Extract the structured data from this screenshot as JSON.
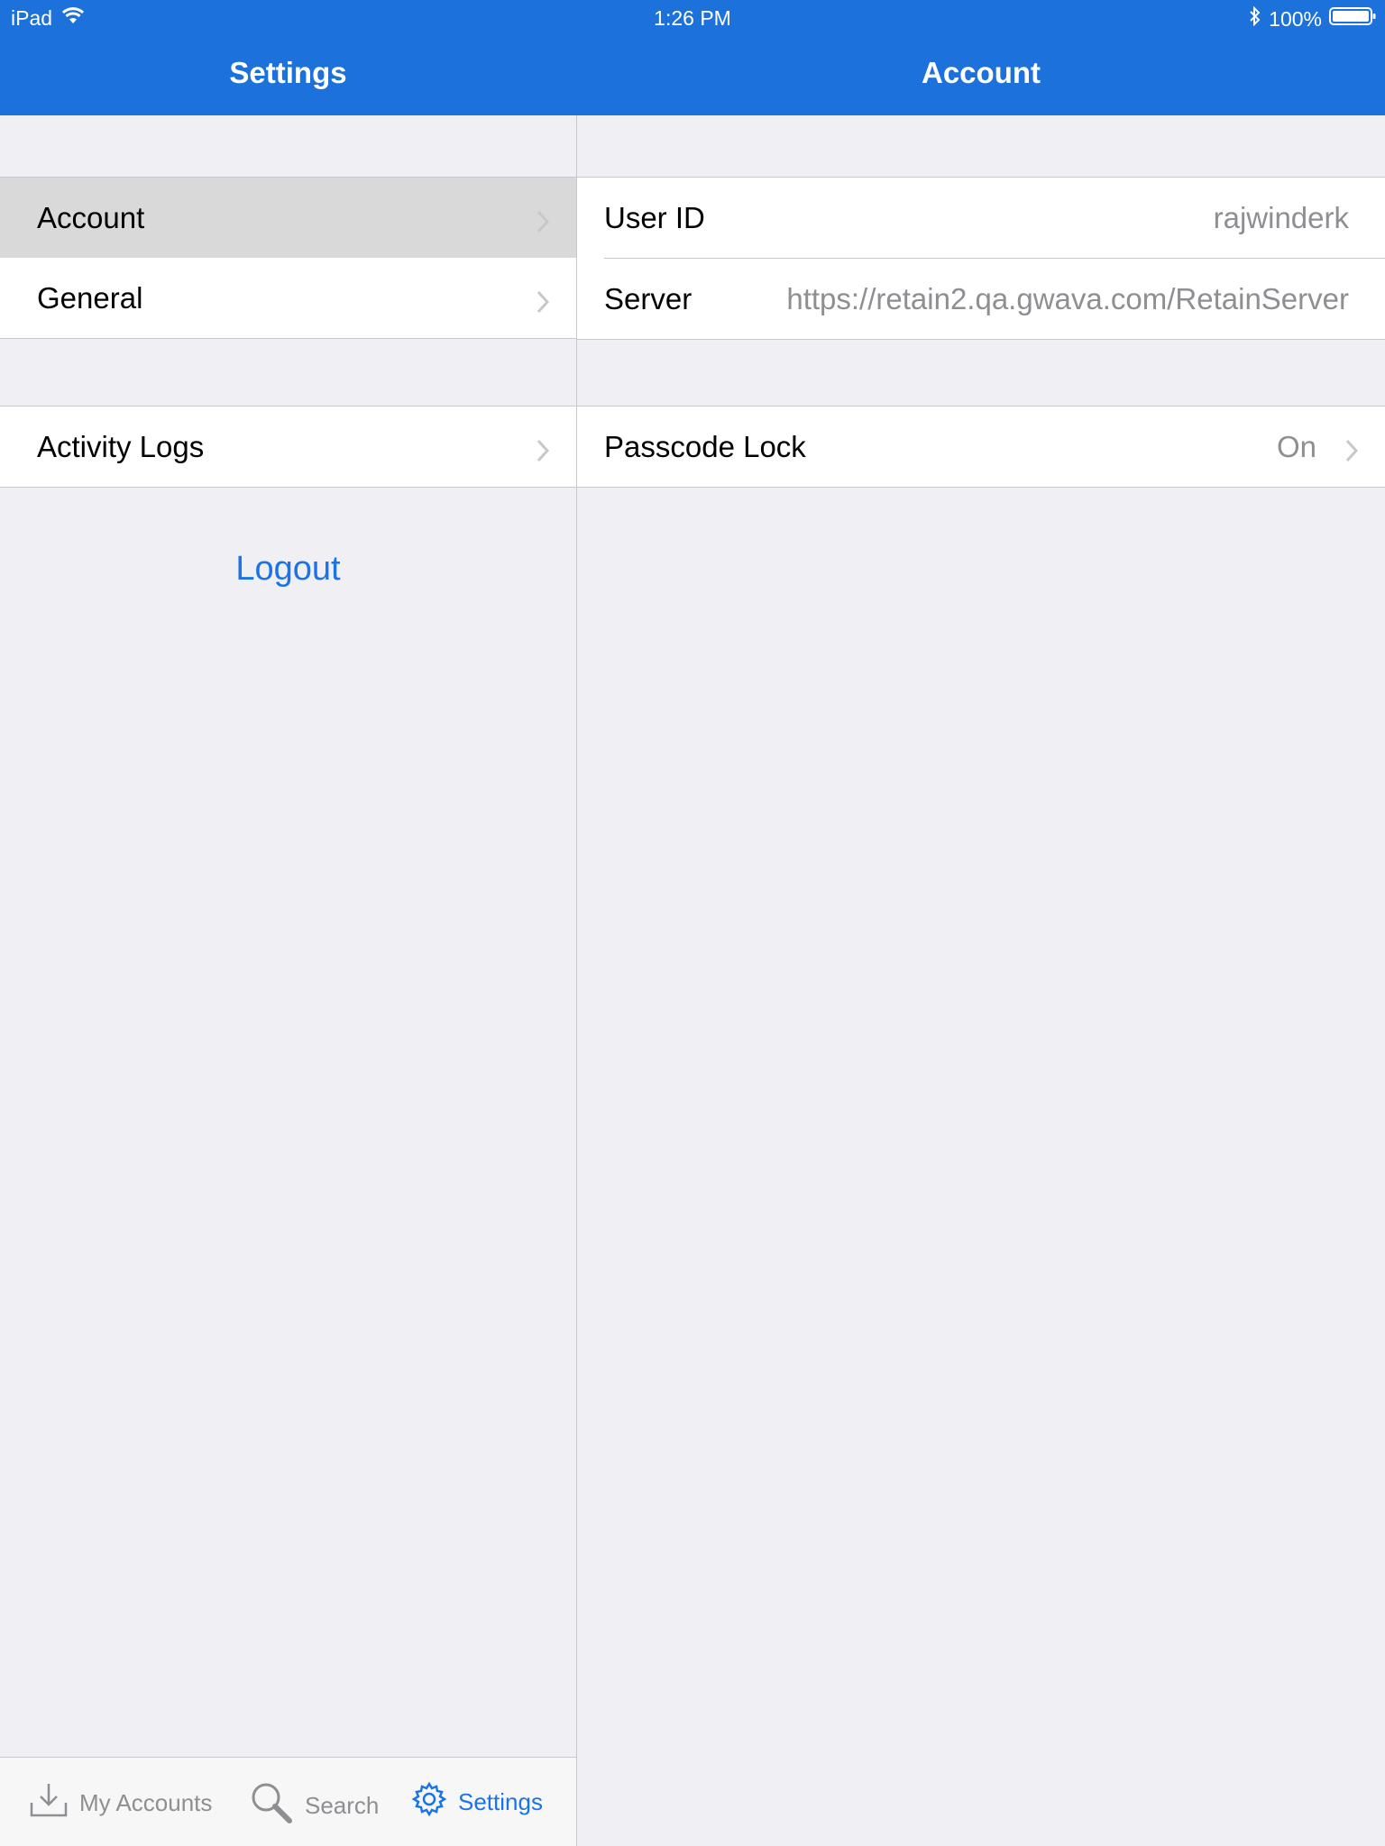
{
  "status_bar": {
    "device": "iPad",
    "time": "1:26 PM",
    "battery": "100%"
  },
  "master": {
    "title": "Settings",
    "items": [
      {
        "label": "Account"
      },
      {
        "label": "General"
      },
      {
        "label": "Activity Logs"
      }
    ],
    "logout_label": "Logout"
  },
  "detail": {
    "title": "Account",
    "user_id": {
      "label": "User ID",
      "value": "rajwinderk"
    },
    "server": {
      "label": "Server",
      "value": "https://retain2.qa.gwava.com/RetainServer"
    },
    "passcode": {
      "label": "Passcode Lock",
      "value": "On"
    }
  },
  "tabs": [
    {
      "label": "My Accounts",
      "icon": "download-tray-icon"
    },
    {
      "label": "Search",
      "icon": "magnifier-icon"
    },
    {
      "label": "Settings",
      "icon": "gear-icon"
    }
  ],
  "colors": {
    "bar": "#1c72da",
    "accent": "#1a73e8",
    "secondary_text": "#8e8e93",
    "background": "#efeff4"
  }
}
